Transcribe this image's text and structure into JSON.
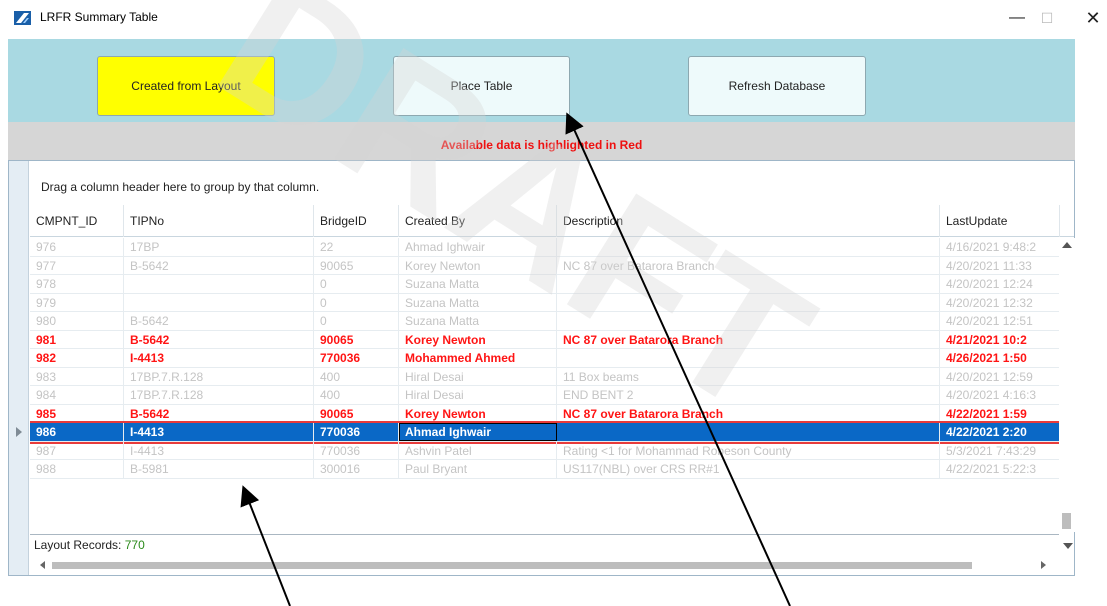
{
  "window": {
    "title": "LRFR Summary Table",
    "minimize": "—",
    "maximize": "☐",
    "close": "✕"
  },
  "toolbar": {
    "created_from_layout": "Created from Layout",
    "place_table": "Place Table",
    "refresh_database": "Refresh Database"
  },
  "notice": "Available data is highlighted in Red",
  "grid": {
    "group_panel": "Drag a column header here to group by that column.",
    "columns": [
      "CMPNT_ID",
      "TIPNo",
      "BridgeID",
      "Created By",
      "Description",
      "LastUpdate"
    ],
    "rows": [
      {
        "id": "976",
        "tip": "17BP",
        "bridge": "22",
        "by": "Ahmad Ighwair",
        "desc": "",
        "upd": "4/16/2021 9:48:2",
        "state": "faded"
      },
      {
        "id": "977",
        "tip": "B-5642",
        "bridge": "90065",
        "by": "Korey Newton",
        "desc": "NC 87 over Batarora Branch",
        "upd": "4/20/2021 11:33",
        "state": "faded"
      },
      {
        "id": "978",
        "tip": "",
        "bridge": "0",
        "by": "Suzana Matta",
        "desc": "",
        "upd": "4/20/2021 12:24",
        "state": "faded"
      },
      {
        "id": "979",
        "tip": "",
        "bridge": "0",
        "by": "Suzana Matta",
        "desc": "",
        "upd": "4/20/2021 12:32",
        "state": "faded"
      },
      {
        "id": "980",
        "tip": "B-5642",
        "bridge": "0",
        "by": "Suzana Matta",
        "desc": "",
        "upd": "4/20/2021 12:51",
        "state": "faded"
      },
      {
        "id": "981",
        "tip": "B-5642",
        "bridge": "90065",
        "by": "Korey Newton",
        "desc": "NC 87 over Batarora Branch",
        "upd": "4/21/2021 10:2",
        "state": "highlighted"
      },
      {
        "id": "982",
        "tip": "I-4413",
        "bridge": "770036",
        "by": "Mohammed Ahmed",
        "desc": "",
        "upd": "4/26/2021 1:50",
        "state": "highlighted"
      },
      {
        "id": "983",
        "tip": "17BP.7.R.128",
        "bridge": "400",
        "by": "Hiral Desai",
        "desc": "11 Box beams",
        "upd": "4/20/2021 12:59",
        "state": "faded"
      },
      {
        "id": "984",
        "tip": "17BP.7.R.128",
        "bridge": "400",
        "by": "Hiral Desai",
        "desc": "END BENT 2",
        "upd": "4/20/2021 4:16:3",
        "state": "faded"
      },
      {
        "id": "985",
        "tip": "B-5642",
        "bridge": "90065",
        "by": "Korey Newton",
        "desc": "NC 87 over Batarora Branch",
        "upd": "4/22/2021 1:59",
        "state": "highlighted"
      },
      {
        "id": "986",
        "tip": "I-4413",
        "bridge": "770036",
        "by": "Ahmad Ighwair",
        "desc": "",
        "upd": "4/22/2021 2:20",
        "state": "selected"
      },
      {
        "id": "987",
        "tip": "I-4413",
        "bridge": "770036",
        "by": "Ashvin Patel",
        "desc": "Rating <1 for Mohammad Robeson County",
        "upd": "5/3/2021 7:43:29",
        "state": "faded"
      },
      {
        "id": "988",
        "tip": "B-5981",
        "bridge": "300016",
        "by": "Paul Bryant",
        "desc": "US117(NBL) over CRS RR#1",
        "upd": "4/22/2021 5:22:3",
        "state": "faded"
      }
    ]
  },
  "footer": {
    "label": "Layout Records: ",
    "count": "770"
  },
  "watermark": "DRAFT",
  "colors": {
    "toolbar_bg": "#a9d9e2",
    "accent_yellow": "#ffff00",
    "highlight_red": "#ff1414",
    "selection_blue": "#0a68c6"
  }
}
